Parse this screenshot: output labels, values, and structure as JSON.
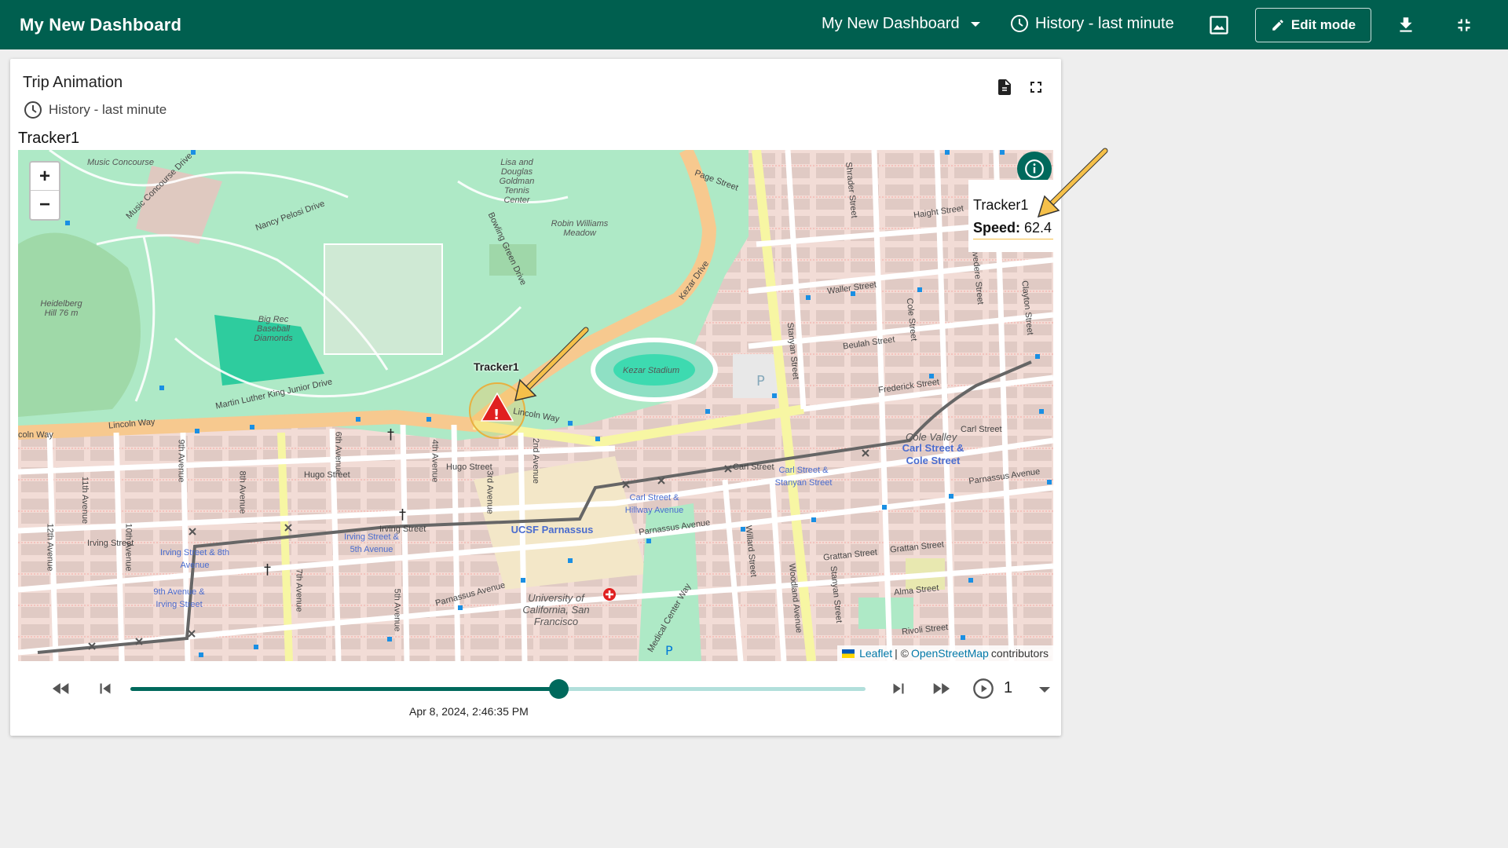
{
  "header": {
    "app_title": "My New Dashboard",
    "dashboard_select": "My New Dashboard",
    "history": "History - last minute",
    "edit_mode": "Edit mode"
  },
  "widget": {
    "title": "Trip Animation",
    "subtitle": "History - last minute",
    "entity_name": "Tracker1"
  },
  "map": {
    "marker_label": "Tracker1",
    "tooltip": {
      "name": "Tracker1",
      "speed_label": "Speed:",
      "speed_value": "62.4"
    },
    "attribution": {
      "leaflet": "Leaflet",
      "separator": "| ©",
      "osm": "OpenStreetMap",
      "suffix": "contributors"
    },
    "labels": {
      "music_concourse": "Music Concourse",
      "music_concourse_drive": "Music Concourse Drive",
      "lisa_tennis": "Lisa and Douglas Goldman Tennis Center",
      "robin_williams": "Robin Williams Meadow",
      "nancy_pelosi": "Nancy Pelosi Drive",
      "bowling_green": "Bowling Green Drive",
      "kezar_drive": "Kezar Drive",
      "page_street": "Page Street",
      "haight_street": "Haight Street",
      "waller_street": "Waller Street",
      "beulah_street": "Beulah Street",
      "frederick_street": "Frederick Street",
      "heidelberg": "Heidelberg Hill 76 m",
      "big_rec": "Big Rec Baseball Diamonds",
      "kezar_stadium": "Kezar Stadium",
      "mlk_drive": "Martin Luther King Junior Drive",
      "lincoln_way_1": "Lincoln Way",
      "lincoln_way_2": "Lincoln Way",
      "lincoln_way_3": "coln Way",
      "hugo_street_1": "Hugo Street",
      "hugo_street_2": "Hugo Street",
      "irving_street_1": "Irving Street",
      "irving_street_2": "Irving Street",
      "carl_street": "Carl Street",
      "carl_street_2": "Carl Street",
      "parnassus_1": "Parnassus Avenue",
      "parnassus_2": "Parnassus Avenue",
      "parnassus_3": "Parnassus Avenue",
      "grattan_1": "Grattan Street",
      "grattan_2": "Grattan Street",
      "alma_street": "Alma Street",
      "rivoli_street": "Rivoli Street",
      "cole_valley": "Cole Valley",
      "ucsf": "University of California, San Francisco",
      "stanyan": "Stanyan Street",
      "willard": "Willard Street",
      "woodland": "Woodland Avenue",
      "medical_center": "Medical Center Way",
      "av_12": "12th Avenue",
      "av_11": "11th Avenue",
      "av_10": "10th Avenue",
      "av_9": "9th Avenue",
      "av_8": "8th Avenue",
      "av_7": "7th Avenue",
      "av_6": "6th Avenue",
      "av_5": "5th Avenue",
      "av_4": "4th Avenue",
      "av_3": "3rd Avenue",
      "av_2": "2nd Avenue",
      "shrader": "Shrader Street",
      "cole": "Cole Street",
      "belvedere": "Belvedere Street",
      "clayton": "Clayton Street",
      "p": "P"
    },
    "stops": {
      "irving_8th": "Irving Street & 8th Avenue",
      "irving_5th": "Irving Street & 5th Avenue",
      "ninth_irving": "9th Avenue & Irving Street",
      "ucsf_parnassus": "UCSF Parnassus",
      "carl_hillway": "Carl Street & Hillway Avenue",
      "carl_stanyan": "Carl Street & Stanyan Street",
      "carl_cole": "Carl Street & Cole Street"
    }
  },
  "player": {
    "progress": 0.582,
    "time": "Apr 8, 2024, 2:46:35 PM",
    "speed_multiplier": "1"
  }
}
